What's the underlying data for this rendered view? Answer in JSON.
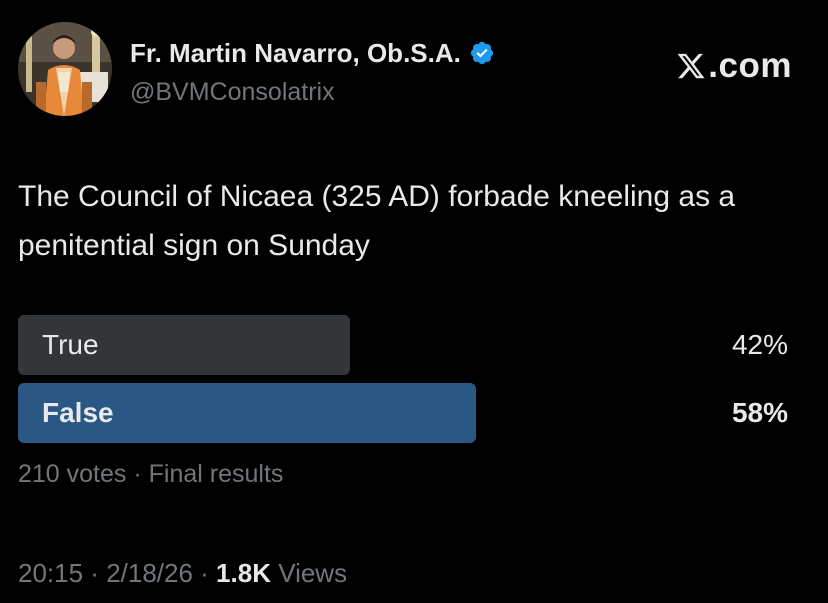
{
  "author": {
    "display_name": "Fr. Martin Navarro, Ob.S.A.",
    "handle": "@BVMConsolatrix",
    "verified_icon": "verified-badge-icon",
    "verified_color": "#1d9bf0"
  },
  "brand": {
    "icon": "x-logo-icon",
    "text": "𝕏.com",
    "label": ".com"
  },
  "tweet": {
    "text": "The Council of Nicaea (325 AD) forbade kneeling as a penitential sign on Sunday"
  },
  "poll": {
    "options": [
      {
        "label": "True",
        "percent_text": "42%",
        "percent": 42,
        "winner": false
      },
      {
        "label": "False",
        "percent_text": "58%",
        "percent": 58,
        "winner": true
      }
    ],
    "votes": "210 votes",
    "separator": " · ",
    "status": "Final results",
    "colors": {
      "bar": "#333639",
      "winner_bar": "#2a5783"
    }
  },
  "meta": {
    "time": "20:15",
    "separator": " · ",
    "date": "2/18/26",
    "views_count": "1.8K",
    "views_label": " Views"
  },
  "colors": {
    "background": "#000000",
    "primary_text": "#e7e9ea",
    "secondary_text": "#71767b"
  }
}
